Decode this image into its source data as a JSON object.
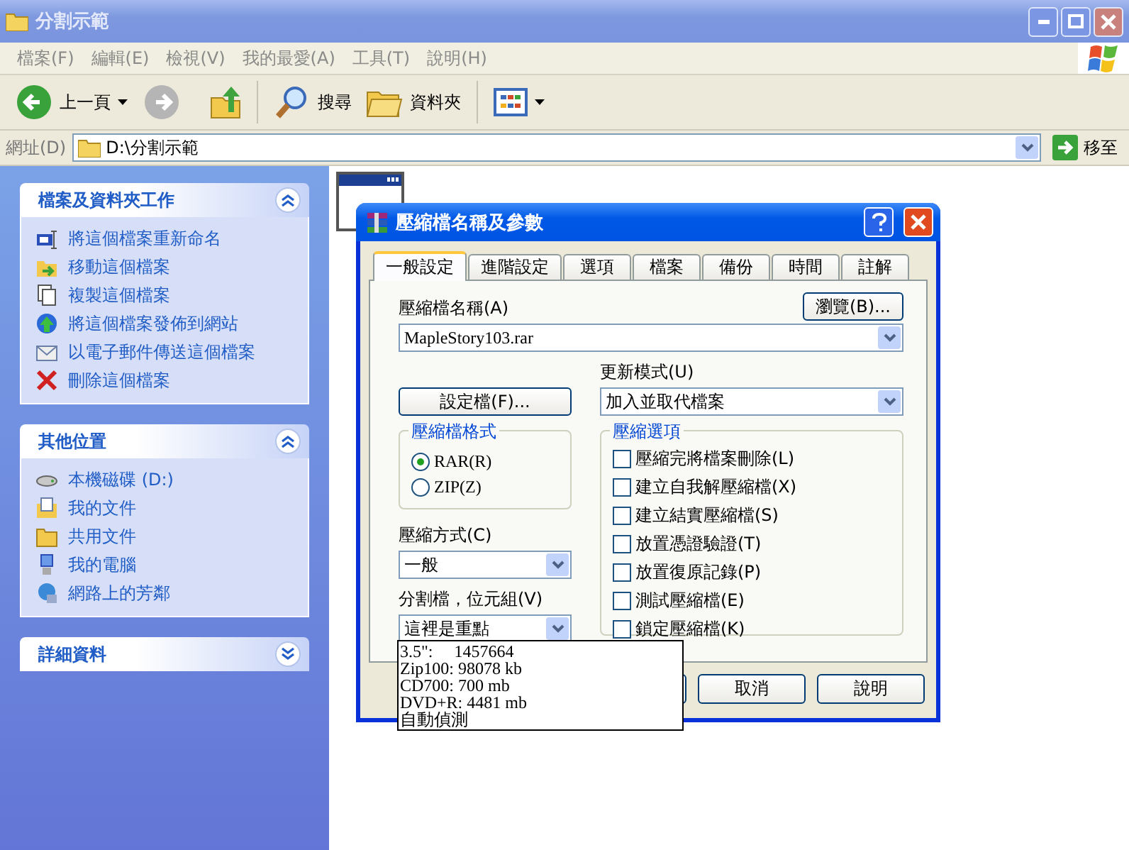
{
  "window": {
    "title": "分割示範",
    "focused": false
  },
  "menu": [
    "檔案(F)",
    "編輯(E)",
    "檢視(V)",
    "我的最愛(A)",
    "工具(T)",
    "說明(H)"
  ],
  "toolbar": {
    "back": "上一頁",
    "search": "搜尋",
    "folders": "資料夾"
  },
  "address": {
    "label": "網址(D)",
    "value": "D:\\分割示範",
    "go": "移至"
  },
  "sidebar": {
    "panels": [
      {
        "title": "檔案及資料夾工作",
        "expanded": true,
        "items": [
          {
            "label": "將這個檔案重新命名",
            "kind": "rename"
          },
          {
            "label": "移動這個檔案",
            "kind": "move"
          },
          {
            "label": "複製這個檔案",
            "kind": "copy"
          },
          {
            "label": "將這個檔案發佈到網站",
            "kind": "publish"
          },
          {
            "label": "以電子郵件傳送這個檔案",
            "kind": "email"
          },
          {
            "label": "刪除這個檔案",
            "kind": "delete"
          }
        ]
      },
      {
        "title": "其他位置",
        "expanded": true,
        "items": [
          {
            "label": "本機磁碟 (D:)",
            "kind": "drive"
          },
          {
            "label": "我的文件",
            "kind": "documents"
          },
          {
            "label": "共用文件",
            "kind": "folder"
          },
          {
            "label": "我的電腦",
            "kind": "computer"
          },
          {
            "label": "網路上的芳鄰",
            "kind": "network"
          }
        ]
      },
      {
        "title": "詳細資料",
        "expanded": false
      }
    ]
  },
  "dialog": {
    "title": "壓縮檔名稱及參數",
    "tabs": [
      {
        "label": "一般設定",
        "selected": true
      },
      {
        "label": "進階設定",
        "selected": false
      },
      {
        "label": "選項",
        "selected": false
      },
      {
        "label": "檔案",
        "selected": false
      },
      {
        "label": "備份",
        "selected": false
      },
      {
        "label": "時間",
        "selected": false
      },
      {
        "label": "註解",
        "selected": false
      }
    ],
    "archive_name": {
      "label": "壓縮檔名稱(A)",
      "value": "MapleStory103.rar"
    },
    "browse_button": "瀏覽(B)...",
    "profiles_button": "設定檔(F)...",
    "update_mode": {
      "label": "更新模式(U)",
      "value": "加入並取代檔案"
    },
    "format": {
      "title": "壓縮檔格式",
      "options": [
        {
          "label": "RAR(R)",
          "selected": true
        },
        {
          "label": "ZIP(Z)",
          "selected": false
        }
      ]
    },
    "method": {
      "label": "壓縮方式(C)",
      "value": "一般"
    },
    "split": {
      "label": "分割檔，位元組(V)",
      "value": "這裡是重點",
      "expanded": true,
      "options": [
        "3.5\":     1457664",
        "Zip100: 98078 kb",
        "CD700: 700 mb",
        "DVD+R: 4481 mb",
        "自動偵測"
      ]
    },
    "options": {
      "title": "壓縮選項",
      "items": [
        {
          "label": "壓縮完將檔案刪除(L)",
          "checked": false
        },
        {
          "label": "建立自我解壓縮檔(X)",
          "checked": false
        },
        {
          "label": "建立結實壓縮檔(S)",
          "checked": false
        },
        {
          "label": "放置憑證驗證(T)",
          "checked": false
        },
        {
          "label": "放置復原記錄(P)",
          "checked": false
        },
        {
          "label": "測試壓縮檔(E)",
          "checked": false
        },
        {
          "label": "鎖定壓縮檔(K)",
          "checked": false
        }
      ]
    },
    "buttons": [
      "取消",
      "說明"
    ]
  }
}
